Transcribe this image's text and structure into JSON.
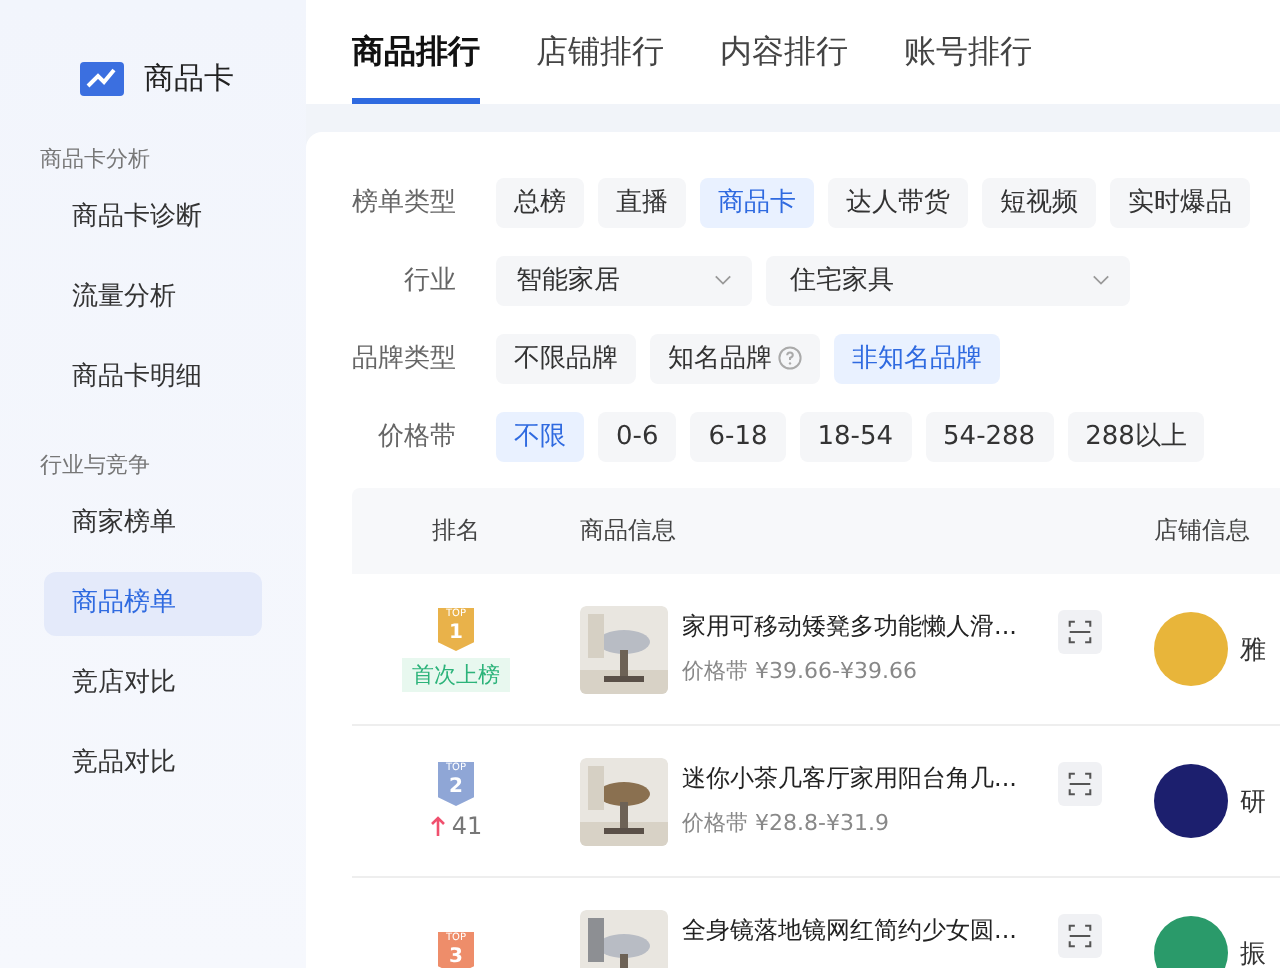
{
  "sidebar": {
    "title": "商品卡",
    "groups": [
      {
        "label": "商品卡分析",
        "items": [
          {
            "label": "商品卡诊断",
            "selected": false
          },
          {
            "label": "流量分析",
            "selected": false
          },
          {
            "label": "商品卡明细",
            "selected": false
          }
        ]
      },
      {
        "label": "行业与竞争",
        "items": [
          {
            "label": "商家榜单",
            "selected": false
          },
          {
            "label": "商品榜单",
            "selected": true
          },
          {
            "label": "竞店对比",
            "selected": false
          },
          {
            "label": "竞品对比",
            "selected": false
          }
        ]
      }
    ]
  },
  "tabs": [
    {
      "label": "商品排行",
      "selected": true
    },
    {
      "label": "店铺排行",
      "selected": false
    },
    {
      "label": "内容排行",
      "selected": false
    },
    {
      "label": "账号排行",
      "selected": false
    }
  ],
  "filters": [
    {
      "kind": "chips",
      "label": "榜单类型",
      "options": [
        {
          "label": "总榜",
          "selected": false
        },
        {
          "label": "直播",
          "selected": false
        },
        {
          "label": "商品卡",
          "selected": true
        },
        {
          "label": "达人带货",
          "selected": false
        },
        {
          "label": "短视频",
          "selected": false
        },
        {
          "label": "实时爆品",
          "selected": false
        }
      ]
    },
    {
      "kind": "selects",
      "label": "行业",
      "selects": [
        {
          "value": "智能家居"
        },
        {
          "value": "住宅家具"
        }
      ]
    },
    {
      "kind": "chips",
      "label": "品牌类型",
      "options": [
        {
          "label": "不限品牌",
          "selected": false
        },
        {
          "label": "知名品牌",
          "selected": false,
          "help": true
        },
        {
          "label": "非知名品牌",
          "selected": true
        }
      ]
    },
    {
      "kind": "chips",
      "label": "价格带",
      "options": [
        {
          "label": "不限",
          "selected": true
        },
        {
          "label": "0-6",
          "selected": false
        },
        {
          "label": "6-18",
          "selected": false
        },
        {
          "label": "18-54",
          "selected": false
        },
        {
          "label": "54-288",
          "selected": false
        },
        {
          "label": "288以上",
          "selected": false
        }
      ]
    }
  ],
  "table": {
    "columns": [
      "排名",
      "商品信息",
      "店铺信息"
    ],
    "rows": [
      {
        "rank": "1",
        "badge": "TOP",
        "kind": "new",
        "change": "首次上榜",
        "title": "家用可移动矮凳多功能懒人滑...",
        "price_label": "价格带",
        "price": "¥39.66-¥39.66",
        "store": "雅",
        "color": "#e8b53a"
      },
      {
        "rank": "2",
        "badge": "TOP",
        "kind": "up",
        "change": "41",
        "title": "迷你小茶几客厅家用阳台角几...",
        "price_label": "价格带",
        "price": "¥28.8-¥31.9",
        "store": "研",
        "color": "#1c1f6e"
      },
      {
        "rank": "3",
        "badge": "TOP",
        "title": "全身镜落地镜网红简约少女圆...",
        "store": "振",
        "color": "#2a9a6a"
      }
    ]
  }
}
